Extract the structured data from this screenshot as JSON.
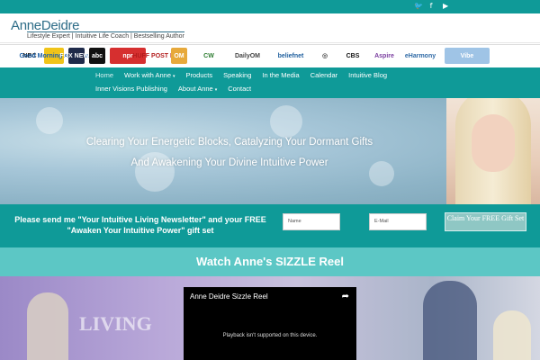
{
  "social": {
    "icons": [
      "twitter-icon",
      "facebook-icon",
      "youtube-icon"
    ],
    "glyphs": [
      "🐦",
      "f",
      "▶"
    ]
  },
  "brand": {
    "name": "AnneDeidre",
    "tagline": "Lifestyle Expert | Intuitive Life Coach | Bestselling Author"
  },
  "press_logos": [
    {
      "label": "NBC",
      "bg": "#ffffff",
      "fg": "#222"
    },
    {
      "label": "Good Morning America",
      "bg": "#f0c419",
      "fg": "#1b5ea6"
    },
    {
      "label": "FOX NEWS",
      "bg": "#1f2b4a",
      "fg": "#ffffff"
    },
    {
      "label": "abc",
      "bg": "#111111",
      "fg": "#ffffff"
    },
    {
      "label": "npr",
      "bg": "#d62f2f",
      "fg": "#ffffff"
    },
    {
      "label": "HUFF POST LIVE",
      "bg": "#ffffff",
      "fg": "#b31d1d"
    },
    {
      "label": "OM",
      "bg": "#e7a93b",
      "fg": "#ffffff"
    },
    {
      "label": "CW",
      "bg": "#ffffff",
      "fg": "#2e7d32"
    },
    {
      "label": "DailyOM",
      "bg": "#ffffff",
      "fg": "#444"
    },
    {
      "label": "beliefnet",
      "bg": "#ffffff",
      "fg": "#1f5f9e"
    },
    {
      "label": "◎",
      "bg": "#ffffff",
      "fg": "#555"
    },
    {
      "label": "CBS",
      "bg": "#ffffff",
      "fg": "#111"
    },
    {
      "label": "Aspire",
      "bg": "#ffffff",
      "fg": "#7b3fa0"
    },
    {
      "label": "eHarmony",
      "bg": "#ffffff",
      "fg": "#2f6aa6"
    },
    {
      "label": "Vibe",
      "bg": "#9fc4e6",
      "fg": "#ffffff"
    }
  ],
  "nav": {
    "row1": [
      {
        "label": "Home",
        "active": true,
        "dropdown": false
      },
      {
        "label": "Work with Anne",
        "active": false,
        "dropdown": true
      },
      {
        "label": "Products",
        "active": false,
        "dropdown": false
      },
      {
        "label": "Speaking",
        "active": false,
        "dropdown": false
      },
      {
        "label": "In the Media",
        "active": false,
        "dropdown": false
      },
      {
        "label": "Calendar",
        "active": false,
        "dropdown": false
      },
      {
        "label": "Intuitive Blog",
        "active": false,
        "dropdown": false
      }
    ],
    "row2": [
      {
        "label": "Inner Visions Publishing",
        "active": false,
        "dropdown": false
      },
      {
        "label": "About Anne",
        "active": false,
        "dropdown": true
      },
      {
        "label": "Contact",
        "active": false,
        "dropdown": false
      }
    ]
  },
  "hero": {
    "line1": "Clearing Your Energetic Blocks, Catalyzing Your Dormant Gifts",
    "line2": "And Awakening Your Divine Intuitive Power"
  },
  "signup": {
    "text": "Please send me \"Your Intuitive Living Newsletter\" and your FREE \"Awaken Your Intuitive Power\" gift set",
    "name_placeholder": "Name",
    "email_placeholder": "E-Mail",
    "button": "Claim Your FREE Gift Set"
  },
  "sizzle": {
    "title": "Watch Anne's SIZZLE Reel",
    "background_text": "LIVING",
    "video_title": "Anne Deidre Sizzle Reel",
    "share_glyph": "➦",
    "message": "Playback isn't supported on this device."
  },
  "colors": {
    "teal": "#0f9a98",
    "light_teal": "#5cc7c5",
    "brand_blue": "#2d6c87"
  }
}
